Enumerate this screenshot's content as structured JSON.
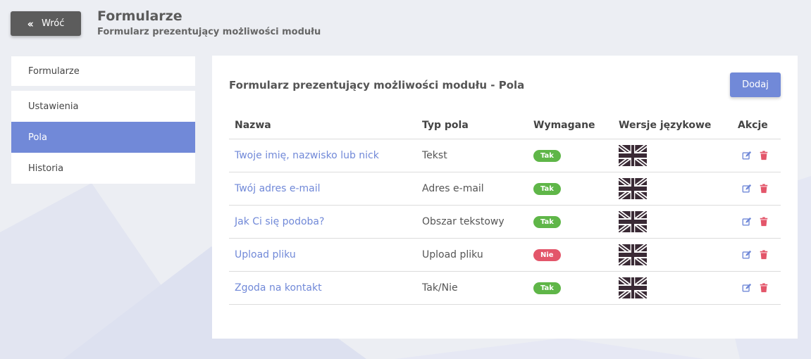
{
  "header": {
    "back_label": "Wróć",
    "title": "Formularze",
    "subtitle": "Formularz prezentujący możliwości modułu"
  },
  "sidebar": {
    "items": [
      {
        "label": "Formularze",
        "active": false
      },
      {
        "label": "Ustawienia",
        "active": false
      },
      {
        "label": "Pola",
        "active": true
      },
      {
        "label": "Historia",
        "active": false
      }
    ]
  },
  "panel": {
    "title": "Formularz prezentujący możliwości modułu - Pola",
    "add_label": "Dodaj",
    "columns": [
      "Nazwa",
      "Typ pola",
      "Wymagane",
      "Wersje językowe",
      "Akcje"
    ],
    "rows": [
      {
        "name": "Twoje imię, nazwisko lub nick",
        "type": "Tekst",
        "required": "Tak"
      },
      {
        "name": "Twój adres e-mail",
        "type": "Adres e-mail",
        "required": "Tak"
      },
      {
        "name": "Jak Ci się podoba?",
        "type": "Obszar tekstowy",
        "required": "Tak"
      },
      {
        "name": "Upload pliku",
        "type": "Upload pliku",
        "required": "Nie"
      },
      {
        "name": "Zgoda na kontakt",
        "type": "Tak/Nie",
        "required": "Tak"
      }
    ]
  },
  "icons": {
    "back": "double-chevron-left-icon",
    "language": "uk-flag-icon",
    "edit": "edit-icon",
    "delete": "trash-icon"
  },
  "colors": {
    "accent": "#7189d8",
    "yes_badge": "#5fb648",
    "no_badge": "#e3566a",
    "back_button": "#5c5c5c"
  }
}
